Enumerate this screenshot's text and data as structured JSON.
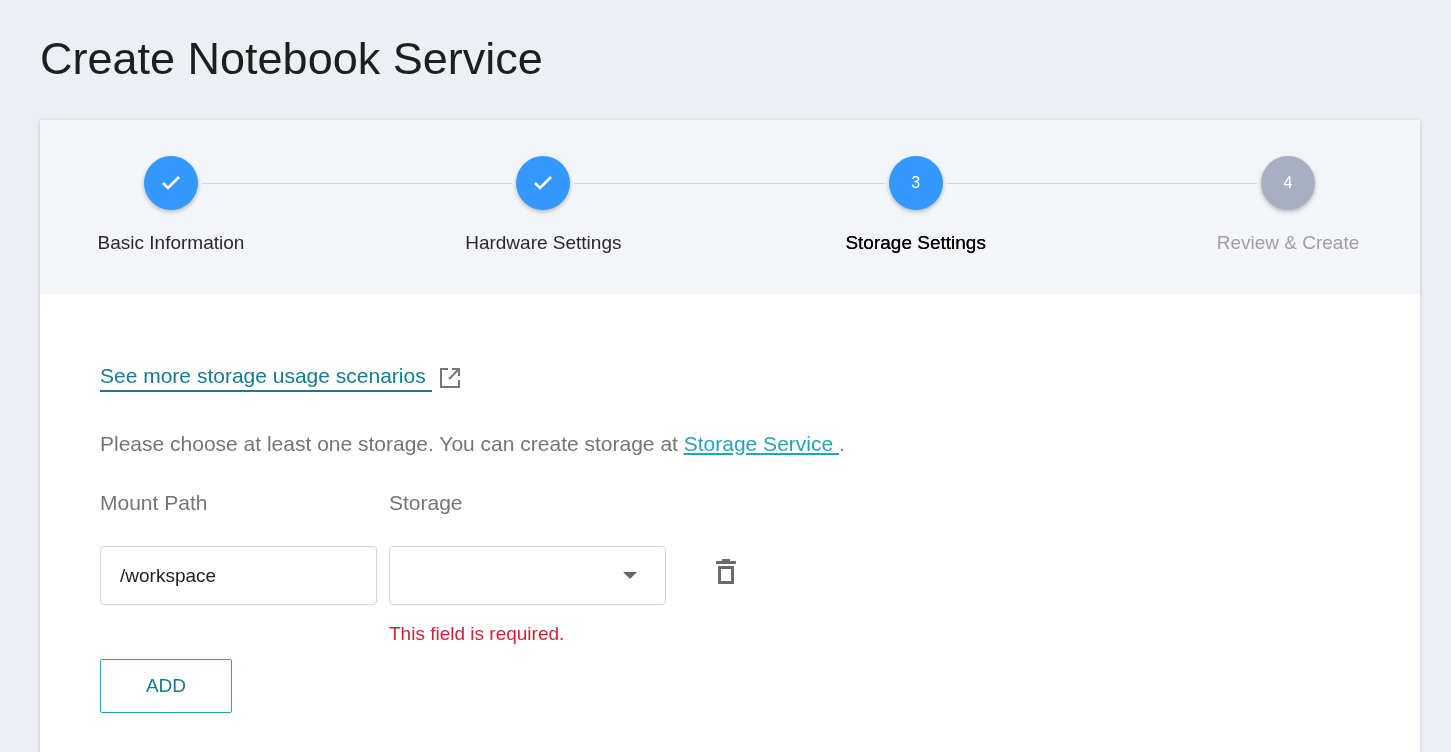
{
  "page": {
    "title": "Create Notebook Service"
  },
  "stepper": {
    "steps": [
      {
        "label": "Basic Information",
        "completed": true,
        "selected": false
      },
      {
        "label": "Hardware Settings",
        "completed": true,
        "selected": false
      },
      {
        "label": "Storage Settings",
        "completed": false,
        "selected": true,
        "number": "3"
      },
      {
        "label": "Review & Create",
        "completed": false,
        "selected": false,
        "number": "4"
      }
    ]
  },
  "storage_form": {
    "scenarios_link": "See more storage usage scenarios",
    "note": {
      "text": "Please choose at least one storage. You can create storage at ",
      "link": "Storage Service ",
      "end": "."
    },
    "columns": [
      "Mount Path",
      "Storage"
    ],
    "rows": [
      {
        "mount_path": "/workspace",
        "error": "This field is required."
      }
    ],
    "add_button": "ADD"
  }
}
